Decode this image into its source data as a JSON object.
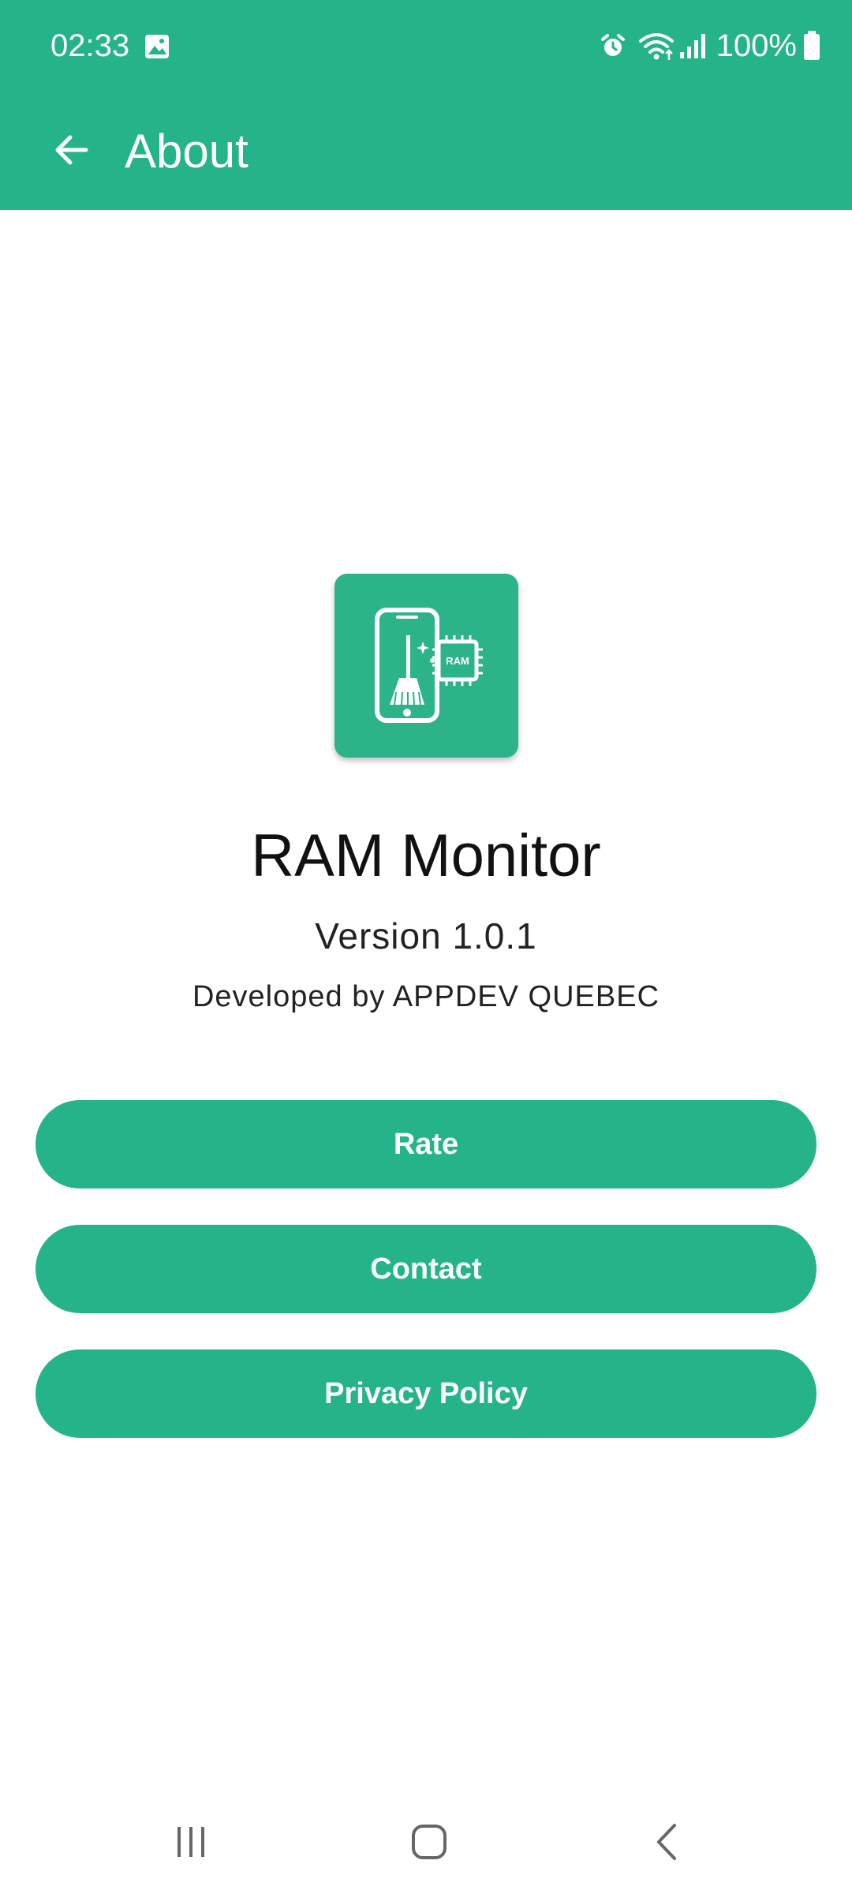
{
  "status_bar": {
    "time": "02:33",
    "battery": "100%",
    "icons": [
      "gallery-icon",
      "alarm-icon",
      "wifi-icon",
      "signal-icon",
      "battery-icon"
    ]
  },
  "toolbar": {
    "title": "About",
    "back_icon": "arrow-left-icon",
    "background": "#25B489"
  },
  "about": {
    "icon": "ram-cleaner-app-icon",
    "icon_label": "RAM",
    "app_name": "RAM Monitor",
    "version": "Version 1.0.1",
    "developer": "Developed by APPDEV QUEBEC"
  },
  "buttons": {
    "rate": "Rate",
    "contact": "Contact",
    "privacy": "Privacy Policy",
    "color": "#25B489"
  },
  "nav_bar": {
    "icons": [
      "recents-icon",
      "home-icon",
      "back-icon"
    ]
  }
}
